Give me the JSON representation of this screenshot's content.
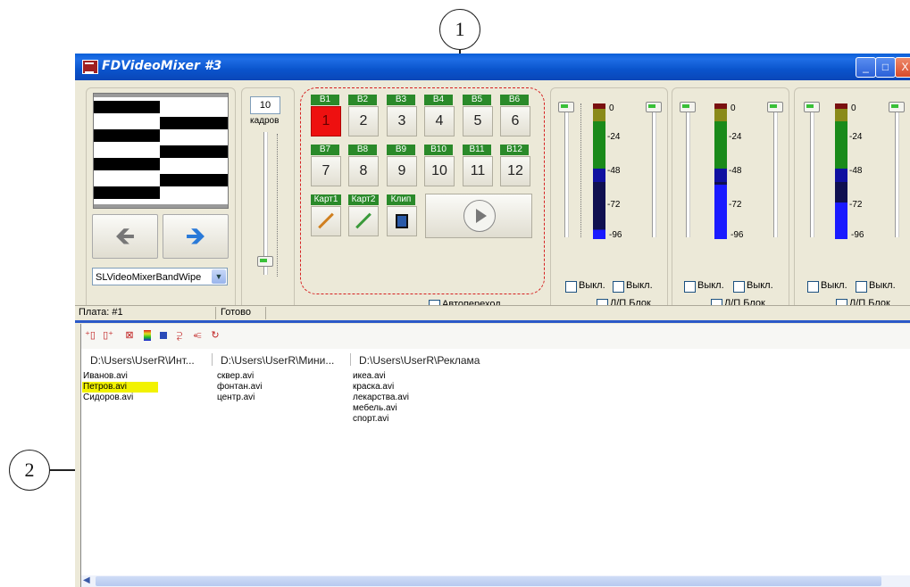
{
  "callouts": {
    "one": "1",
    "two": "2"
  },
  "window": {
    "title": "FDVideoMixer #3",
    "minimize": "_",
    "maximize": "□",
    "close": "X"
  },
  "preview": {
    "prev_arrow": "🡸",
    "next_arrow": "🡺",
    "transition_select": "SLVideoMixerBandWipe"
  },
  "frames": {
    "value": "10",
    "label": "кадров"
  },
  "sources": {
    "row1": [
      {
        "label": "B1",
        "num": "1"
      },
      {
        "label": "B2",
        "num": "2"
      },
      {
        "label": "B3",
        "num": "3"
      },
      {
        "label": "B4",
        "num": "4"
      },
      {
        "label": "B5",
        "num": "5"
      },
      {
        "label": "B6",
        "num": "6"
      }
    ],
    "row2": [
      {
        "label": "B7",
        "num": "7"
      },
      {
        "label": "B8",
        "num": "8"
      },
      {
        "label": "B9",
        "num": "9"
      },
      {
        "label": "B10",
        "num": "10"
      },
      {
        "label": "B11",
        "num": "11"
      },
      {
        "label": "B12",
        "num": "12"
      }
    ],
    "kart1": "Карт1",
    "kart2": "Карт2",
    "klip": "Клип",
    "auto_transition": "Автопереход"
  },
  "audio": {
    "scale": [
      "0",
      "-24",
      "-48",
      "-72",
      "-96"
    ],
    "mute_left": "Выкл.",
    "mute_right": "Выкл.",
    "lr_block": "Л/П Блок"
  },
  "status": {
    "board": "Плата: #1",
    "state": "Готово"
  },
  "playlists": {
    "columns": [
      {
        "header": "D:\\Users\\UserR\\Инт...",
        "files": [
          "Иванов.avi",
          "Петров.avi",
          "Сидоров.avi"
        ]
      },
      {
        "header": "D:\\Users\\UserR\\Мини...",
        "files": [
          "сквер.avi",
          "фонтан.avi",
          "центр.avi"
        ]
      },
      {
        "header": "D:\\Users\\UserR\\Реклама",
        "files": [
          "икеа.avi",
          "краска.avi",
          "лекарства.avi",
          "мебель.avi",
          "спорт.avi"
        ]
      }
    ],
    "highlight_color": "#f2f200"
  }
}
